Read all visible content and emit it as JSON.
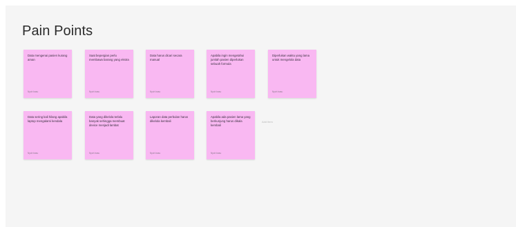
{
  "board": {
    "title": "Pain Points",
    "add_label": "Add item"
  },
  "colors": {
    "note_background": "#f9b8f2",
    "board_background": "#f5f5f5"
  },
  "notes": [
    {
      "text": "Data mengenai pasien kurang aman",
      "author": "Nyoh basu"
    },
    {
      "text": "Saat bepergian perlu membawa barang yang ekstra",
      "author": "Nyoh basu"
    },
    {
      "text": "Data harus dicari secara manual",
      "author": "Nyoh basu"
    },
    {
      "text": "Apabila ingin mengetahui jumlah pasien diperlukan sebuah formula",
      "author": "Nyoh basu"
    },
    {
      "text": "Diperlukan waktu yang lama untuk mengelola data",
      "author": "Nyoh basu"
    },
    {
      "text": "Data sering kali hilang apabila laptop mengalami kendala",
      "author": "Nyoh basu"
    },
    {
      "text": "Data yang dikelola terlalu banyak sehingga membuat device menjadi lambat",
      "author": "Nyoh basu"
    },
    {
      "text": "Laporan data perbulan harus dikelola kembali",
      "author": "Nyoh basu"
    },
    {
      "text": "Apabila ada pasien lama yang berkunjung harus dikala kembali",
      "author": "Nyoh basu"
    }
  ]
}
